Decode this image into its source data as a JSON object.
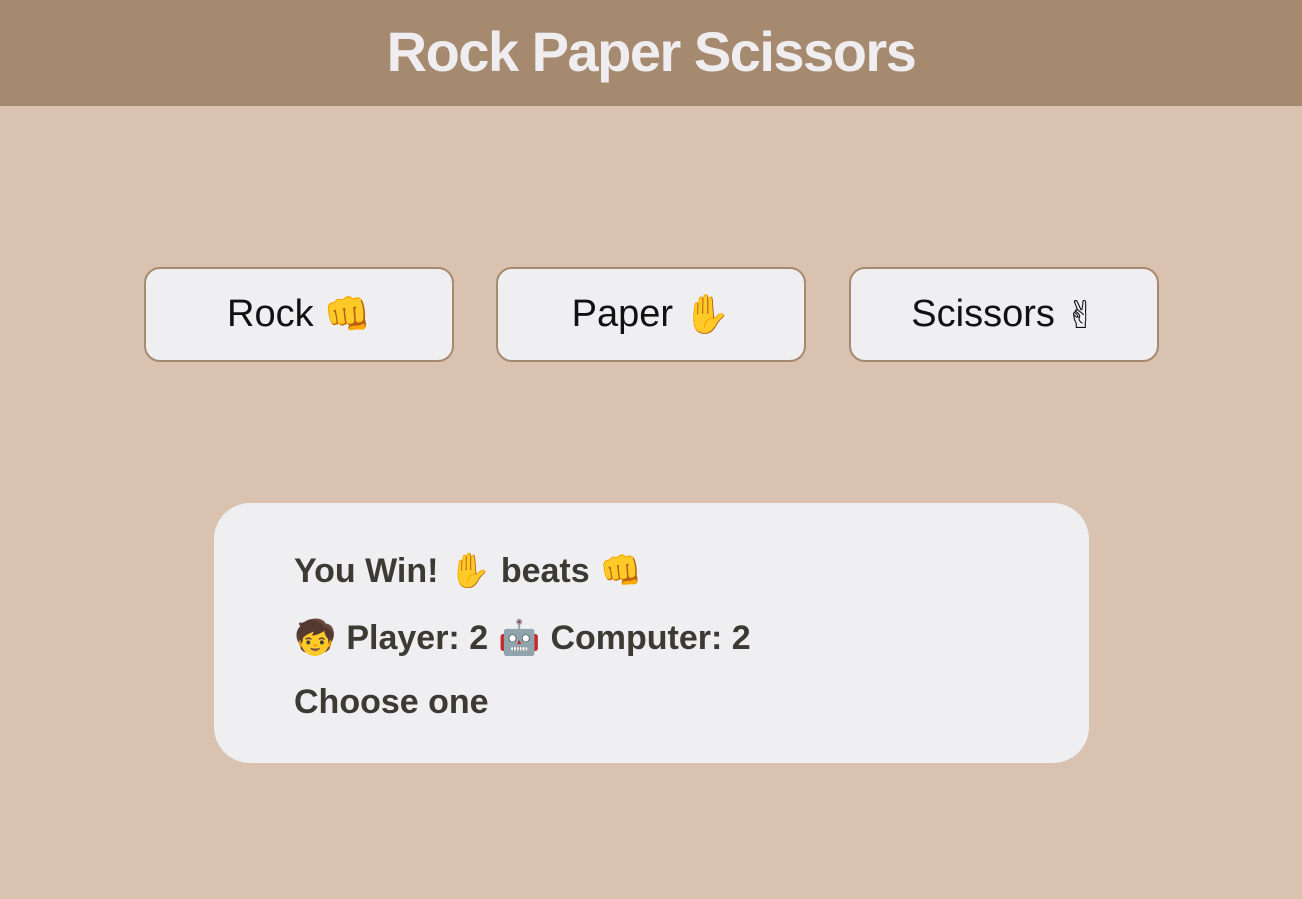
{
  "header": {
    "title": "Rock Paper Scissors"
  },
  "choices": [
    {
      "label": "Rock",
      "emoji": "👊"
    },
    {
      "label": "Paper",
      "emoji": "✋"
    },
    {
      "label": "Scissors",
      "emoji": "✌"
    }
  ],
  "result": {
    "outcome_text": "You Win!",
    "player_choice_emoji": "✋",
    "beats_text": "beats",
    "computer_choice_emoji": "👊",
    "player_icon": "🧒",
    "player_label": "Player: 2",
    "computer_icon": "🤖",
    "computer_label": "Computer: 2",
    "prompt": "Choose one"
  },
  "colors": {
    "background": "#d9c2af",
    "header": "#a68a70",
    "title_text": "#efedf0",
    "panel": "#efeff1",
    "button_border": "#a68a70",
    "panel_text": "#3c3a33"
  }
}
